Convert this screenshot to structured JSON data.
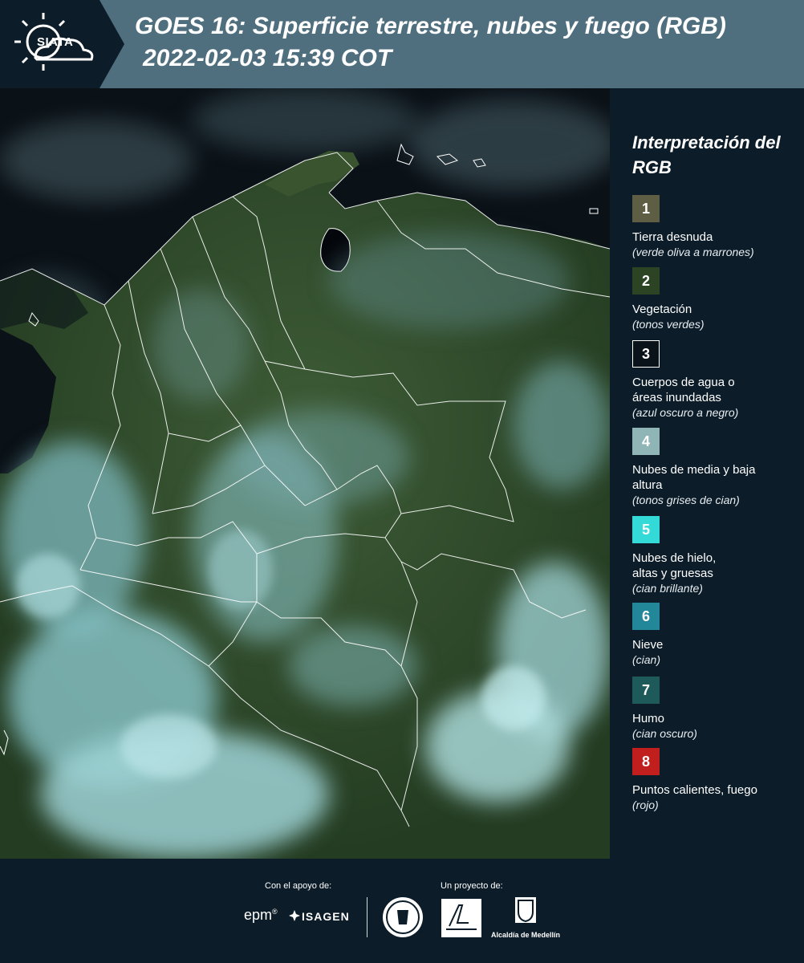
{
  "header": {
    "logo_text": "SIATA",
    "title_line1": "GOES 16: Superficie terrestre, nubes y fuego (RGB)",
    "title_line2": "2022-02-03 15:39 COT"
  },
  "map": {
    "icon": "satellite-rgb-composite-colombia",
    "colors": {
      "vegetation": "#2e4a2a",
      "vegetation_light": "#3d5c34",
      "cloud": "#8fc7cc",
      "cloud_bright": "#b5e3e6",
      "water": "#060a10",
      "border": "#ffffff"
    }
  },
  "legend": {
    "title": "Interpretación del RGB",
    "items": [
      {
        "number": "1",
        "label": "Tierra desnuda",
        "sub": "(verde oliva a marrones)",
        "color": "#5e5e44"
      },
      {
        "number": "2",
        "label": "Vegetación",
        "sub": "(tonos verdes)",
        "color": "#2c4424"
      },
      {
        "number": "3",
        "label": "Cuerpos de agua o áreas inundadas",
        "sub": "(azul oscuro a negro)",
        "color": "#0a121a"
      },
      {
        "number": "4",
        "label": "Nubes de media y baja altura",
        "sub": "(tonos grises de cian)",
        "color": "#8fb5b6"
      },
      {
        "number": "5",
        "label": "Nubes de hielo, altas y gruesas",
        "sub": "(cian brillante)",
        "color": "#34dad8"
      },
      {
        "number": "6",
        "label": "Nieve",
        "sub": "(cian)",
        "color": "#23879a"
      },
      {
        "number": "7",
        "label": "Humo",
        "sub": "(cian oscuro)",
        "color": "#1f5a5a"
      },
      {
        "number": "8",
        "label": "Puntos calientes, fuego",
        "sub": "(rojo)",
        "color": "#c11e1e"
      }
    ]
  },
  "footer": {
    "support_label": "Con el apoyo de:",
    "project_label": "Un proyecto de:",
    "sponsor1": "epm",
    "sponsor2": "ISAGEN",
    "partner_name": "Alcaldía de Medellín",
    "partner_logos": [
      "universidad-seal-icon",
      "area-metropolitana-logo-icon",
      "alcaldia-medellin-shield-icon"
    ]
  }
}
